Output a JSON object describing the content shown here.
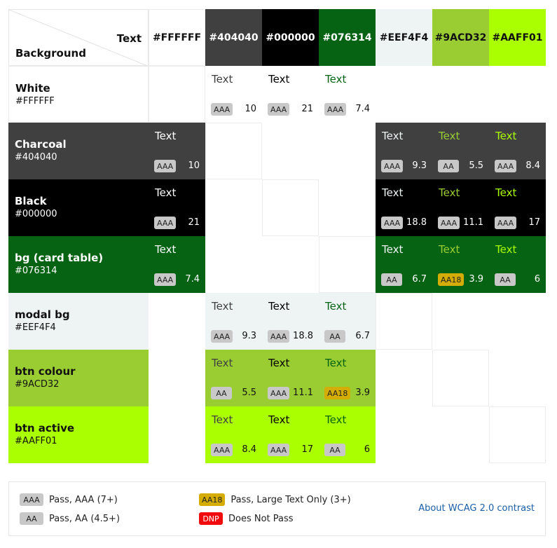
{
  "header": {
    "text_label": "Text",
    "background_label": "Background"
  },
  "columns": [
    {
      "hex": "#FFFFFF",
      "bg": "#FFFFFF",
      "fg": "#111111"
    },
    {
      "hex": "#404040",
      "bg": "#404040",
      "fg": "#FFFFFF"
    },
    {
      "hex": "#000000",
      "bg": "#000000",
      "fg": "#FFFFFF"
    },
    {
      "hex": "#076314",
      "bg": "#076314",
      "fg": "#FFFFFF"
    },
    {
      "hex": "#EEF4F4",
      "bg": "#EEF4F4",
      "fg": "#111111"
    },
    {
      "hex": "#9ACD32",
      "bg": "#9ACD32",
      "fg": "#111111"
    },
    {
      "hex": "#AAFF01",
      "bg": "#AAFF01",
      "fg": "#111111"
    }
  ],
  "rows": [
    {
      "name": "White",
      "hex": "#FFFFFF",
      "bg": "#FFFFFF",
      "fg": "#111111",
      "cells": [
        {
          "type": "empty"
        },
        {
          "type": "result",
          "text": "Text",
          "badge": "AAA",
          "ratio": "10"
        },
        {
          "type": "result",
          "text": "Text",
          "badge": "AAA",
          "ratio": "21"
        },
        {
          "type": "result",
          "text": "Text",
          "badge": "AAA",
          "ratio": "7.4"
        },
        {
          "type": "blank"
        },
        {
          "type": "blank"
        },
        {
          "type": "blank"
        }
      ]
    },
    {
      "name": "Charcoal",
      "hex": "#404040",
      "bg": "#404040",
      "fg": "#FFFFFF",
      "cells": [
        {
          "type": "result",
          "text": "Text",
          "badge": "AAA",
          "ratio": "10"
        },
        {
          "type": "empty"
        },
        {
          "type": "blank"
        },
        {
          "type": "blank"
        },
        {
          "type": "result",
          "text": "Text",
          "badge": "AAA",
          "ratio": "9.3"
        },
        {
          "type": "result",
          "text": "Text",
          "badge": "AA",
          "ratio": "5.5"
        },
        {
          "type": "result",
          "text": "Text",
          "badge": "AAA",
          "ratio": "8.4"
        }
      ]
    },
    {
      "name": "Black",
      "hex": "#000000",
      "bg": "#000000",
      "fg": "#FFFFFF",
      "cells": [
        {
          "type": "result",
          "text": "Text",
          "badge": "AAA",
          "ratio": "21"
        },
        {
          "type": "blank"
        },
        {
          "type": "empty"
        },
        {
          "type": "blank"
        },
        {
          "type": "result",
          "text": "Text",
          "badge": "AAA",
          "ratio": "18.8"
        },
        {
          "type": "result",
          "text": "Text",
          "badge": "AAA",
          "ratio": "11.1"
        },
        {
          "type": "result",
          "text": "Text",
          "badge": "AAA",
          "ratio": "17"
        }
      ]
    },
    {
      "name": "bg (card table)",
      "hex": "#076314",
      "bg": "#076314",
      "fg": "#FFFFFF",
      "cells": [
        {
          "type": "result",
          "text": "Text",
          "badge": "AAA",
          "ratio": "7.4"
        },
        {
          "type": "blank"
        },
        {
          "type": "blank"
        },
        {
          "type": "empty"
        },
        {
          "type": "result",
          "text": "Text",
          "badge": "AA",
          "ratio": "6.7"
        },
        {
          "type": "result",
          "text": "Text",
          "badge": "AA18",
          "ratio": "3.9"
        },
        {
          "type": "result",
          "text": "Text",
          "badge": "AA",
          "ratio": "6"
        }
      ]
    },
    {
      "name": "modal bg",
      "hex": "#EEF4F4",
      "bg": "#EEF4F4",
      "fg": "#111111",
      "cells": [
        {
          "type": "blank"
        },
        {
          "type": "result",
          "text": "Text",
          "badge": "AAA",
          "ratio": "9.3"
        },
        {
          "type": "result",
          "text": "Text",
          "badge": "AAA",
          "ratio": "18.8"
        },
        {
          "type": "result",
          "text": "Text",
          "badge": "AA",
          "ratio": "6.7"
        },
        {
          "type": "empty"
        },
        {
          "type": "blank"
        },
        {
          "type": "blank"
        }
      ]
    },
    {
      "name": "btn colour",
      "hex": "#9ACD32",
      "bg": "#9ACD32",
      "fg": "#111111",
      "cells": [
        {
          "type": "blank"
        },
        {
          "type": "result",
          "text": "Text",
          "badge": "AA",
          "ratio": "5.5"
        },
        {
          "type": "result",
          "text": "Text",
          "badge": "AAA",
          "ratio": "11.1"
        },
        {
          "type": "result",
          "text": "Text",
          "badge": "AA18",
          "ratio": "3.9"
        },
        {
          "type": "blank"
        },
        {
          "type": "empty"
        },
        {
          "type": "blank"
        }
      ]
    },
    {
      "name": "btn active",
      "hex": "#AAFF01",
      "bg": "#AAFF01",
      "fg": "#111111",
      "cells": [
        {
          "type": "blank"
        },
        {
          "type": "result",
          "text": "Text",
          "badge": "AAA",
          "ratio": "8.4"
        },
        {
          "type": "result",
          "text": "Text",
          "badge": "AAA",
          "ratio": "17"
        },
        {
          "type": "result",
          "text": "Text",
          "badge": "AA",
          "ratio": "6"
        },
        {
          "type": "blank"
        },
        {
          "type": "blank"
        },
        {
          "type": "empty"
        }
      ]
    }
  ],
  "legend": {
    "items": [
      {
        "badge": "AAA",
        "label": "Pass, AAA (7+)",
        "kind": "aaa"
      },
      {
        "badge": "AA",
        "label": "Pass, AA (4.5+)",
        "kind": "aa"
      },
      {
        "badge": "AA18",
        "label": "Pass, Large Text Only (3+)",
        "kind": "aa18"
      },
      {
        "badge": "DNP",
        "label": "Does Not Pass",
        "kind": "dnp"
      }
    ],
    "link_text": "About WCAG 2.0 contrast"
  }
}
